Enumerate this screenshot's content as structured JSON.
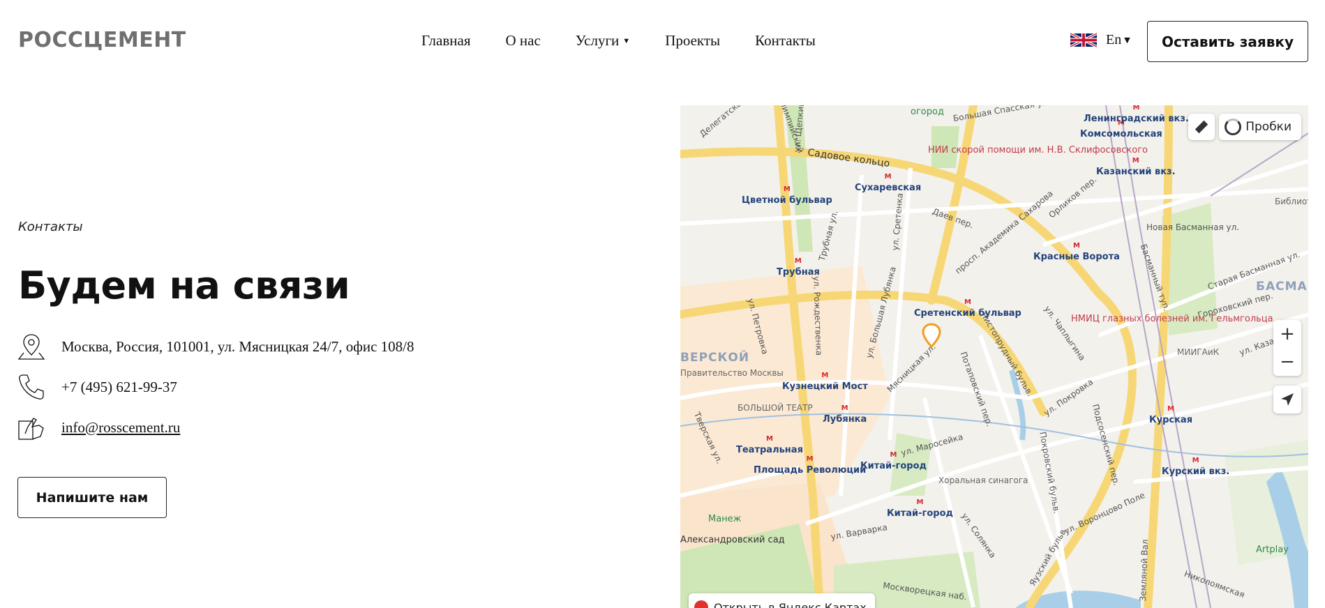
{
  "header": {
    "logo": "РОССЦЕМЕНТ",
    "nav": [
      {
        "label": "Главная"
      },
      {
        "label": "О нас"
      },
      {
        "label": "Услуги",
        "has_dropdown": true
      },
      {
        "label": "Проекты"
      },
      {
        "label": "Контакты"
      }
    ],
    "language": {
      "label": "En",
      "flag": "uk-flag-icon"
    },
    "cta_label": "Оставить заявку"
  },
  "main": {
    "breadcrumb": "Контакты",
    "title": "Будем на связи",
    "contacts": {
      "address": "Москва, Россия, 101001, ул. Мясницкая 24/7, офис 108/8",
      "phone": "+7 (495) 621-99-37",
      "email": "info@rosscement.ru"
    },
    "write_button": "Напишите нам"
  },
  "map": {
    "traffic_label": "Пробки",
    "open_label": "Открыть в Яндекс Картах",
    "zoom_in": "+",
    "zoom_out": "−",
    "labels": {
      "metro": [
        "Сухаревская",
        "Цветной бульвар",
        "Трубная",
        "Сретенский бульвар",
        "Красные Ворота",
        "Комсомольская",
        "Кузнецкий Мост",
        "Лубянка",
        "Театральная",
        "Площадь Революции",
        "Китай-город",
        "Китай-город",
        "Курская"
      ],
      "streets": [
        "Садовое кольцо",
        "Даев пер.",
        "просп. Академика Сахарова",
        "Орликов пер.",
        "Новая Басманная ул.",
        "Старая Басманная ул.",
        "Гороховский пер.",
        "ул. Казак",
        "Басманный туп.",
        "ул. Петровка",
        "ул. Рождественка",
        "ул. Большая Лубянка",
        "Мясницкая ул.",
        "Чистопрудный бульв.",
        "Потаповский пер.",
        "ул. Чаплыгина",
        "ул. Покровка",
        "ул. Маросейка",
        "Покровский бульв.",
        "Подсосенский пер.",
        "ул. Воронцово Поле",
        "ул. Солянка",
        "Яузский бульв.",
        "ул. Варварка",
        "Москворецкая наб.",
        "Николоямская",
        "Земляной Вал",
        "Тверская ул.",
        "Трубная ул.",
        "ул. Сретенка",
        "Большая Спасская ул.",
        "Олимпийский",
        "Делегатская",
        "ул. Щепкина"
      ],
      "pois": [
        "НИИ скорой помощи им. Н.В. Склифосовского",
        "НМИЦ глазных болезней им. Гельмгольца",
        "Ленинградский вкз.",
        "Казанский вкз.",
        "Курский вкз.",
        "МИИГАиК",
        "БОЛЬШОЙ ТЕАТР",
        "Хоральная синагога",
        "Манеж",
        "Александровский сад",
        "Artplay",
        "Правительство Москвы",
        "Библиотека им. Пушкина",
        "огород"
      ],
      "districts": [
        "БАСМАН",
        "ВЕРСКОЙ"
      ]
    }
  }
}
